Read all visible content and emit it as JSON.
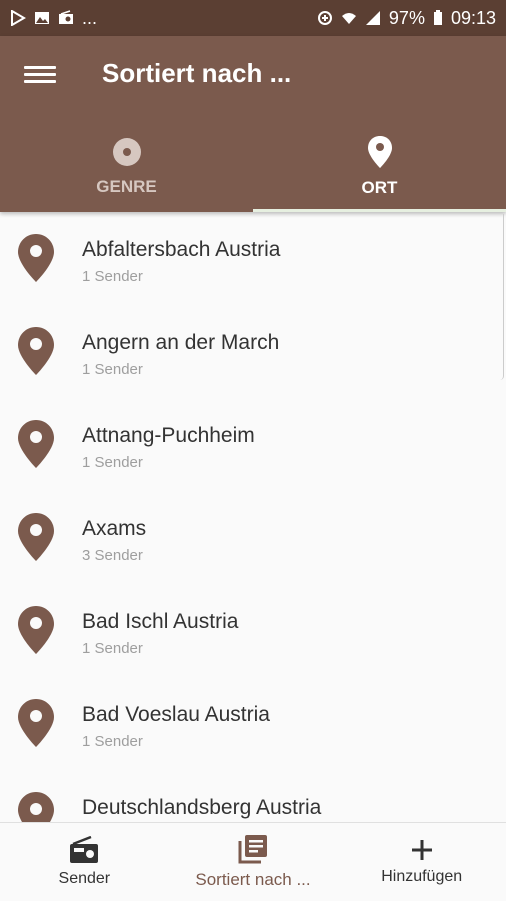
{
  "status_bar": {
    "left_text": "...",
    "battery": "97%",
    "time": "09:13"
  },
  "appbar": {
    "title": "Sortiert nach ..."
  },
  "tabs": [
    {
      "label": "GENRE",
      "icon": "disc-icon",
      "active": false
    },
    {
      "label": "ORT",
      "icon": "location-pin-icon",
      "active": true
    }
  ],
  "list": [
    {
      "title": "Abfaltersbach Austria",
      "sub": "1 Sender"
    },
    {
      "title": "Angern an der March",
      "sub": "1 Sender"
    },
    {
      "title": "Attnang-Puchheim",
      "sub": "1 Sender"
    },
    {
      "title": "Axams",
      "sub": "3 Sender"
    },
    {
      "title": "Bad Ischl Austria",
      "sub": "1 Sender"
    },
    {
      "title": "Bad Voeslau Austria",
      "sub": "1 Sender"
    },
    {
      "title": "Deutschlandsberg Austria",
      "sub": ""
    }
  ],
  "bottom_nav": [
    {
      "label": "Sender",
      "icon": "radio-icon",
      "active": false
    },
    {
      "label": "Sortiert nach ...",
      "icon": "library-icon",
      "active": true
    },
    {
      "label": "Hinzufügen",
      "icon": "plus-icon",
      "active": false
    }
  ],
  "colors": {
    "primary": "#7b5a4d",
    "status_bar": "#5b3f33",
    "background": "#fafafa"
  }
}
